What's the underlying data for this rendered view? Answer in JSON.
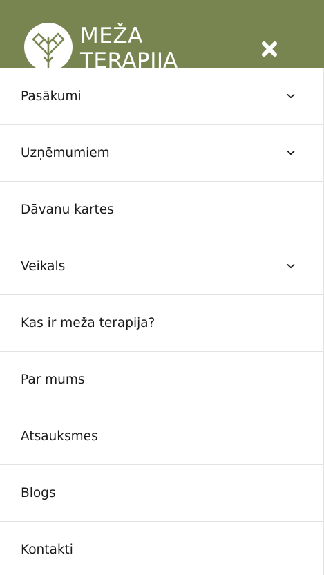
{
  "header": {
    "logo_line1": "MEŽA",
    "logo_line2": "TERAPIJA",
    "background_color": "#788550",
    "close_icon": "close-x-icon"
  },
  "menu": {
    "items": [
      {
        "label": "Pasākumi",
        "has_submenu": true
      },
      {
        "label": "Uzņēmumiem",
        "has_submenu": true
      },
      {
        "label": "Dāvanu kartes",
        "has_submenu": false
      },
      {
        "label": "Veikals",
        "has_submenu": true
      },
      {
        "label": "Kas ir meža terapija?",
        "has_submenu": false
      },
      {
        "label": "Par mums",
        "has_submenu": false
      },
      {
        "label": "Atsauksmes",
        "has_submenu": false
      },
      {
        "label": "Blogs",
        "has_submenu": false
      },
      {
        "label": "Kontakti",
        "has_submenu": false
      }
    ]
  }
}
